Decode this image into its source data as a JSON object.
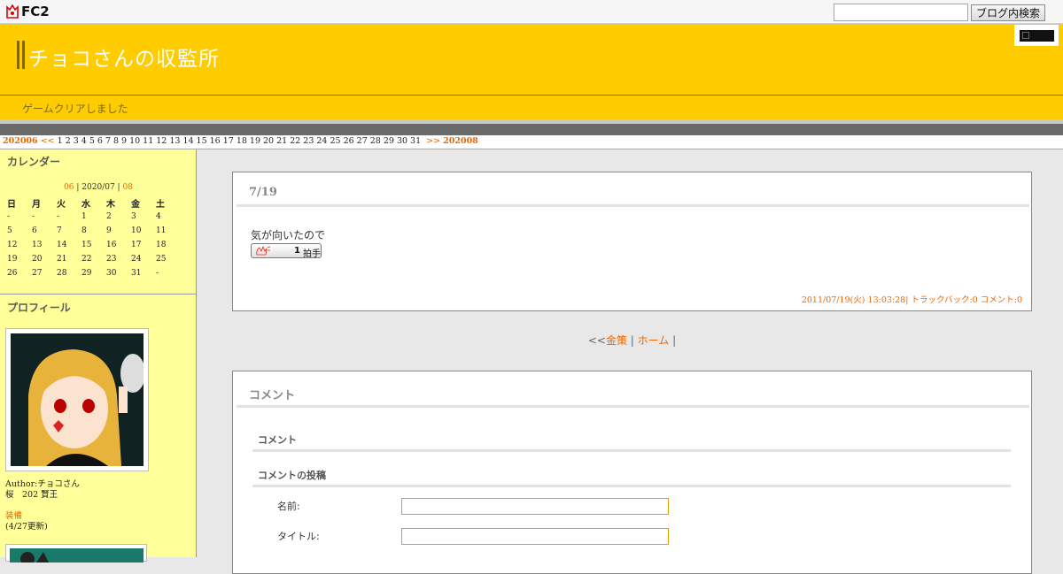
{
  "fc2": {
    "logo_text": "FC2",
    "search_placeholder": "",
    "search_button": "ブログ内検索"
  },
  "header": {
    "title": "チョコさんの収監所",
    "subtitle": "ゲームクリアしました"
  },
  "date_nav": {
    "prev_month": "202006",
    "prev_arrow": "<<",
    "days": [
      "1",
      "2",
      "3",
      "4",
      "5",
      "6",
      "7",
      "8",
      "9",
      "10",
      "11",
      "12",
      "13",
      "14",
      "15",
      "16",
      "17",
      "18",
      "19",
      "20",
      "21",
      "22",
      "23",
      "24",
      "25",
      "26",
      "27",
      "28",
      "29",
      "30",
      "31"
    ],
    "next_arrow": ">>",
    "next_month": "202008"
  },
  "sidebar": {
    "calendar": {
      "heading": "カレンダー",
      "prev": "06",
      "sep1": " | ",
      "current": "2020/07",
      "sep2": " | ",
      "next": "08",
      "weekdays": [
        "日",
        "月",
        "火",
        "水",
        "木",
        "金",
        "土"
      ],
      "weeks": [
        [
          "-",
          "-",
          "-",
          "1",
          "2",
          "3",
          "4"
        ],
        [
          "5",
          "6",
          "7",
          "8",
          "9",
          "10",
          "11"
        ],
        [
          "12",
          "13",
          "14",
          "15",
          "16",
          "17",
          "18"
        ],
        [
          "19",
          "20",
          "21",
          "22",
          "23",
          "24",
          "25"
        ],
        [
          "26",
          "27",
          "28",
          "29",
          "30",
          "31",
          "-"
        ]
      ]
    },
    "profile": {
      "heading": "プロフィール",
      "author_line": "Author:チョコさん",
      "line2": "桜　202 賢王",
      "equip_link": "装備",
      "equip_updated": "(4/27更新)"
    }
  },
  "entry": {
    "title": "7/19",
    "body": "気が向いたので",
    "clap_count": "1",
    "clap_label": "拍手",
    "footer": {
      "datetime": "2011/07/19(火) 13:03:28",
      "sep": "|",
      "trackback": "トラックバック:0",
      "comment": "コメント:0"
    }
  },
  "pager": {
    "prefix": "<<",
    "prev": "金策",
    "sep1": " | ",
    "home": "ホーム",
    "sep2": " |"
  },
  "comments": {
    "title": "コメント",
    "section1": "コメント",
    "section2": "コメントの投稿",
    "name_label": "名前:",
    "title_label": "タイトル:"
  },
  "colors": {
    "header": "#ffcc00",
    "accent": "#ee6600",
    "sidebar": "#ffff99"
  }
}
